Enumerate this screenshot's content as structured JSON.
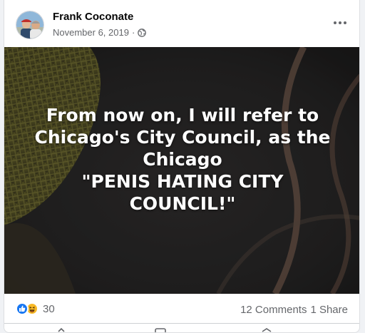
{
  "post": {
    "author": "Frank Coconate",
    "date": "November 6, 2019",
    "separator": "·",
    "privacy_icon": "globe-icon",
    "more_icon": "ellipsis-icon",
    "image_text_lines": [
      "From now on, I will refer to",
      "Chicago's City Council, as the",
      "Chicago",
      "\"PENIS HATING CITY",
      "COUNCIL!\""
    ]
  },
  "stats": {
    "reaction_icons": [
      "like-icon",
      "haha-icon"
    ],
    "reaction_count": "30",
    "comments": "12 Comments",
    "shares": "1 Share"
  },
  "colors": {
    "like_blue": "#1877f2",
    "haha_yellow": "#f7b928",
    "secondary_text": "#65676b"
  }
}
